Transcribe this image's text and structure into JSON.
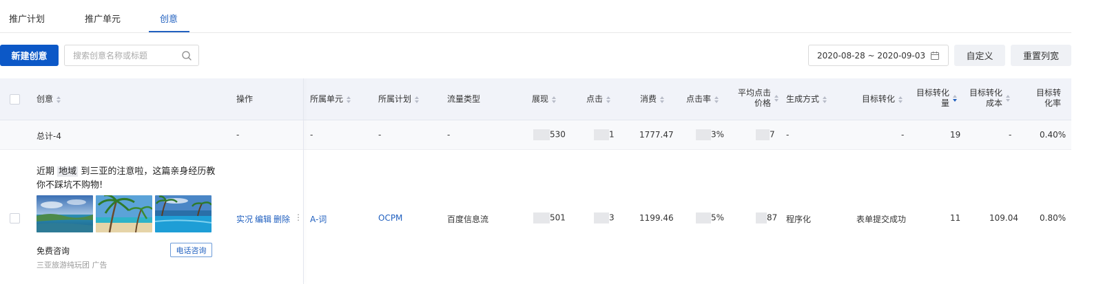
{
  "tabs": [
    {
      "label": "推广计划"
    },
    {
      "label": "推广单元"
    },
    {
      "label": "创意"
    }
  ],
  "toolbar": {
    "new_button": "新建创意",
    "search_placeholder": "搜索创意名称或标题",
    "date_range": "2020-08-28 ~ 2020-09-03",
    "custom_button": "自定义",
    "reset_button": "重置列宽"
  },
  "columns": {
    "creative": "创意",
    "action": "操作",
    "unit": "所属单元",
    "plan": "所属计划",
    "traffic": "流量类型",
    "impressions": "展现",
    "clicks": "点击",
    "cost": "消费",
    "ctr": "点击率",
    "avg_cpc_1": "平均点击",
    "avg_cpc_2": "价格",
    "gen_method": "生成方式",
    "target_conv": "目标转化",
    "target_conv_qty_1": "目标转化",
    "target_conv_qty_2": "量",
    "target_conv_cost_1": "目标转化",
    "target_conv_cost_2": "成本",
    "target_conv_rate_1": "目标转",
    "target_conv_rate_2": "化率"
  },
  "total_row": {
    "label": "总计-4",
    "action": "-",
    "unit": "-",
    "plan": "-",
    "traffic": "-",
    "impressions": "530",
    "clicks": "1",
    "cost": "1777.47",
    "ctr": "3%",
    "avg_cpc": "7",
    "gen_method": "-",
    "target_conv": "-",
    "target_conv_qty": "19",
    "target_conv_cost": "-",
    "target_conv_rate": "0.40%"
  },
  "row": {
    "title_prefix": "近期",
    "title_keyword": "地域",
    "title_suffix": "到三亚的注意啦，这篇亲身经历教你不踩坑不购物!",
    "action_live": "实况",
    "action_edit": "编辑",
    "action_delete": "删除",
    "action_more": "⋮",
    "unit": "A-词",
    "plan": "OCPM",
    "traffic": "百度信息流",
    "impressions": "501",
    "clicks": "3",
    "cost": "1199.46",
    "ctr": "5%",
    "avg_cpc": "87",
    "gen_method": "程序化",
    "target_conv": "表单提交成功",
    "target_conv_qty": "11",
    "target_conv_cost": "109.04",
    "target_conv_rate": "0.80%",
    "consult_label": "免费咨询",
    "call_button": "电话咨询",
    "advertiser": "三亚旅游纯玩团 广告"
  },
  "colors": {
    "accent": "#1f5fbf",
    "primary_button": "#0c58c7",
    "header_bg": "#f1f3f9"
  }
}
